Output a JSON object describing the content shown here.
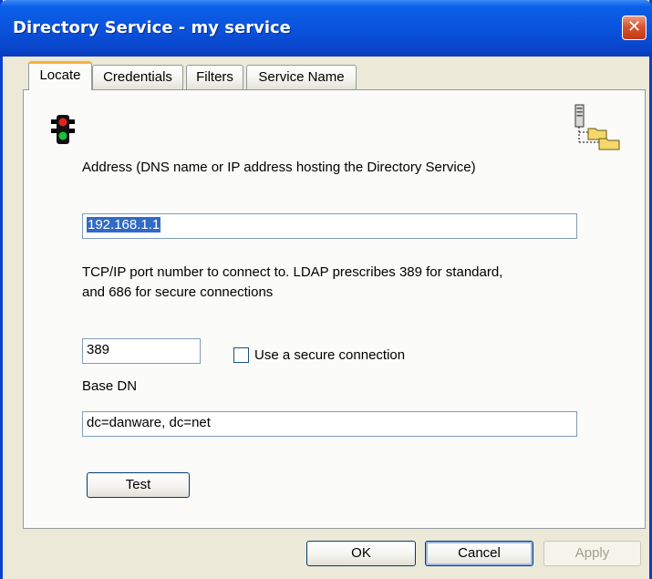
{
  "window": {
    "title": "Directory Service - my service",
    "close_glyph": "✕"
  },
  "tabs": [
    {
      "label": "Locate",
      "active": true
    },
    {
      "label": "Credentials",
      "active": false
    },
    {
      "label": "Filters",
      "active": false
    },
    {
      "label": "Service Name",
      "active": false
    }
  ],
  "locate": {
    "traffic_light_icon": "traffic-light-icon",
    "directory_tree_icon": "directory-tree-icon",
    "address_label": "Address (DNS name or IP address hosting the Directory Service)",
    "address_value": "192.168.1.1",
    "port_label_line1": "TCP/IP port number to connect to. LDAP prescribes 389 for standard,",
    "port_label_line2": "and 686 for secure connections",
    "port_value": "389",
    "secure_label": "Use a secure connection",
    "secure_checked": false,
    "base_dn_label": "Base DN",
    "base_dn_value": "dc=danware, dc=net",
    "test_button": "Test"
  },
  "footer": {
    "ok_label": "OK",
    "cancel_label": "Cancel",
    "apply_label": "Apply",
    "apply_enabled": false
  },
  "colors": {
    "titlebar": "#0a52db",
    "dialog_bg": "#ece9d8",
    "selection": "#316ac5",
    "active_tab_accent": "#f7b23a"
  }
}
